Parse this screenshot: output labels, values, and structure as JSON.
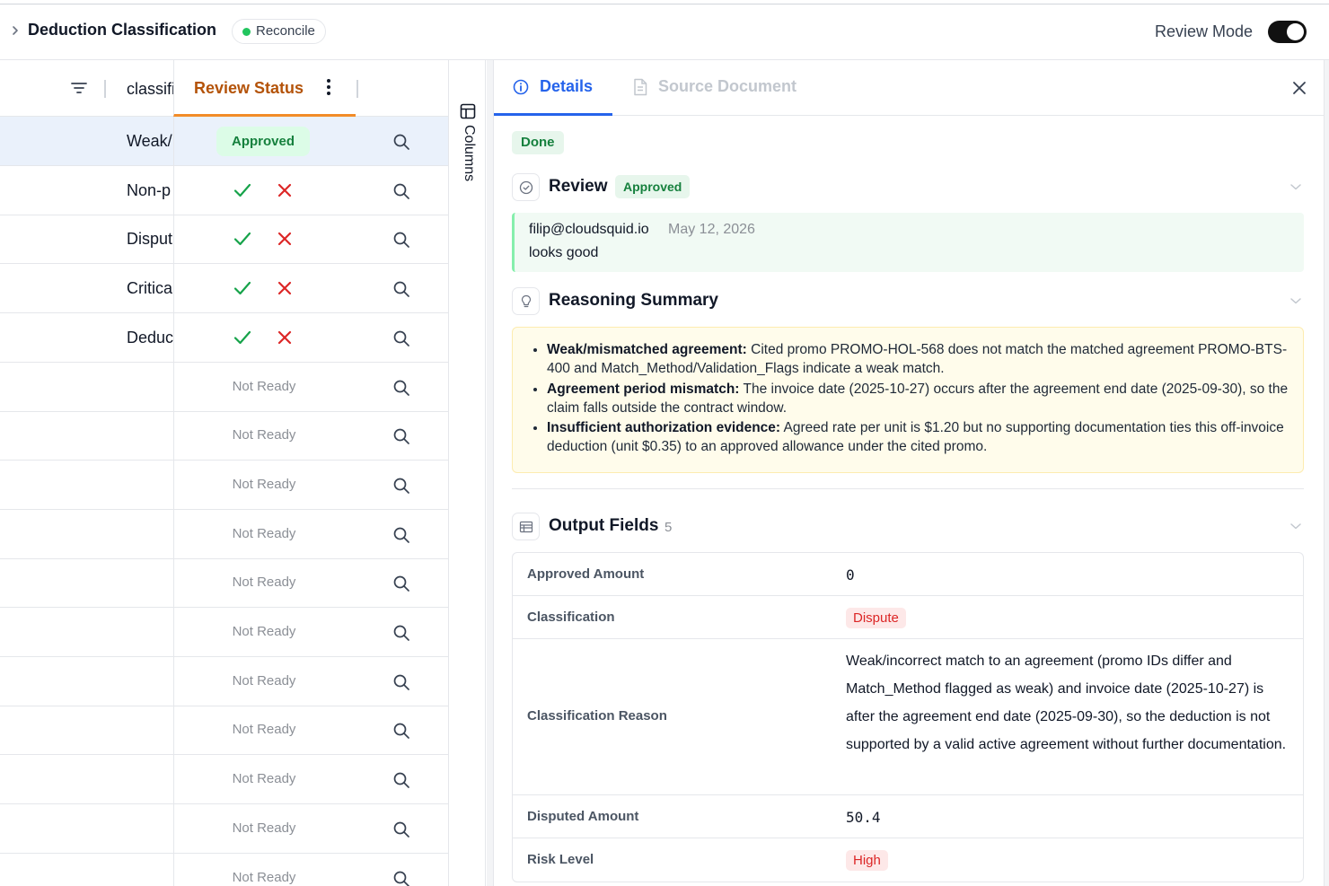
{
  "header": {
    "title": "Deduction Classification",
    "badge": "Reconcile",
    "review_mode_label": "Review Mode",
    "review_mode_on": true
  },
  "grid": {
    "columns": {
      "classification": "classification",
      "review_status": "Review Status"
    },
    "rows": [
      {
        "classification": "Weak/",
        "status": "Approved"
      },
      {
        "classification": "Non-p",
        "status": "pending"
      },
      {
        "classification": "Disput",
        "status": "pending"
      },
      {
        "classification": "Critica",
        "status": "pending"
      },
      {
        "classification": "Deduc",
        "status": "pending"
      },
      {
        "classification": "",
        "status": "Not Ready"
      },
      {
        "classification": "",
        "status": "Not Ready"
      },
      {
        "classification": "",
        "status": "Not Ready"
      },
      {
        "classification": "",
        "status": "Not Ready"
      },
      {
        "classification": "",
        "status": "Not Ready"
      },
      {
        "classification": "",
        "status": "Not Ready"
      },
      {
        "classification": "",
        "status": "Not Ready"
      },
      {
        "classification": "",
        "status": "Not Ready"
      },
      {
        "classification": "",
        "status": "Not Ready"
      },
      {
        "classification": "",
        "status": "Not Ready"
      },
      {
        "classification": "",
        "status": "Not Ready"
      }
    ]
  },
  "columns_panel": {
    "label": "Columns"
  },
  "details": {
    "tabs": {
      "details": "Details",
      "source": "Source Document"
    },
    "state_badge": "Done",
    "review": {
      "title": "Review",
      "badge": "Approved",
      "comment": {
        "author": "filip@cloudsquid.io",
        "date": "May 12, 2026",
        "text": "looks good"
      }
    },
    "reasoning": {
      "title": "Reasoning Summary",
      "items": [
        {
          "label": "Weak/mismatched agreement:",
          "text": " Cited promo PROMO-HOL-568 does not match the matched agreement PROMO-BTS-400 and Match_Method/Validation_Flags indicate a weak match."
        },
        {
          "label": "Agreement period mismatch:",
          "text": " The invoice date (2025-10-27) occurs after the agreement end date (2025-09-30), so the claim falls outside the contract window."
        },
        {
          "label": "Insufficient authorization evidence:",
          "text": " Agreed rate per unit is $1.20 but no supporting documentation ties this off-invoice deduction (unit $0.35) to an approved allowance under the cited promo."
        }
      ]
    },
    "output": {
      "title": "Output Fields",
      "count": "5",
      "fields": [
        {
          "label": "Approved Amount",
          "value": "0"
        },
        {
          "label": "Classification",
          "value": "Dispute"
        },
        {
          "label": "Classification Reason",
          "value": "Weak/incorrect match to an agreement (promo IDs differ and Match_Method flagged as weak) and invoice date (2025-10-27) is after the agreement end date (2025-09-30), so the deduction is not supported by a valid active agreement without further documentation."
        },
        {
          "label": "Disputed Amount",
          "value": "50.4"
        },
        {
          "label": "Risk Level",
          "value": "High"
        }
      ]
    }
  },
  "colors": {
    "accent": "#2563eb",
    "approved": "#15803d",
    "danger": "#dc2626",
    "active_column": "#f28c28"
  }
}
